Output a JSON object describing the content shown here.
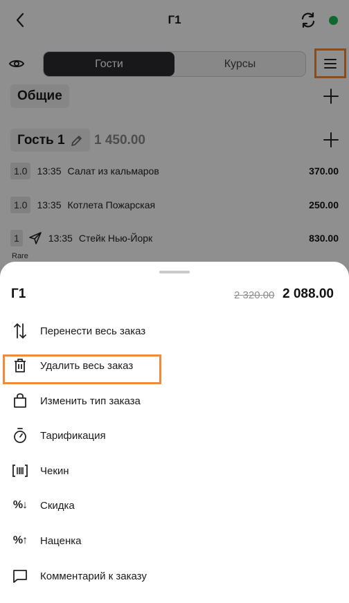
{
  "header": {
    "back_icon": "chevron-left-icon",
    "title": "Г1",
    "sync_icon": "refresh-icon",
    "status_color": "#1db954"
  },
  "tabs": {
    "eye_icon": "eye-icon",
    "items": [
      {
        "label": "Гости",
        "active": true
      },
      {
        "label": "Курсы",
        "active": false
      }
    ],
    "menu_icon": "hamburger-menu-icon"
  },
  "general_section": {
    "label": "Общие"
  },
  "guest": {
    "label": "Гость 1",
    "total": "1 450.00"
  },
  "orders": [
    {
      "qty": "1.0",
      "time": "13:35",
      "name": "Салат из кальмаров",
      "price": "370.00",
      "sent": false
    },
    {
      "qty": "1.0",
      "time": "13:35",
      "name": "Котлета Пожарская",
      "price": "250.00",
      "sent": false
    },
    {
      "qty": "1",
      "time": "13:35",
      "name": "Стейк Нью-Йорк",
      "price": "830.00",
      "sent": true,
      "modifier": "Rare"
    }
  ],
  "sheet": {
    "title": "Г1",
    "old_total": "2 320.00",
    "new_total": "2 088.00",
    "items": [
      {
        "label": "Перенести весь заказ",
        "icon": "transfer-arrows-icon"
      },
      {
        "label": "Удалить весь заказ",
        "icon": "trash-icon"
      },
      {
        "label": "Изменить тип заказа",
        "icon": "bag-icon"
      },
      {
        "label": "Тарификация",
        "icon": "stopwatch-icon"
      },
      {
        "label": "Чекин",
        "icon": "barcode-scan-icon"
      },
      {
        "label": "Скидка",
        "icon": "percent-down-icon"
      },
      {
        "label": "Наценка",
        "icon": "percent-up-icon"
      },
      {
        "label": "Комментарий к заказу",
        "icon": "comment-icon"
      }
    ]
  },
  "colors": {
    "highlight": "#f08a3c",
    "active_tab": "#2b2b2f",
    "overlay": "rgba(0,0,0,0.44)"
  }
}
